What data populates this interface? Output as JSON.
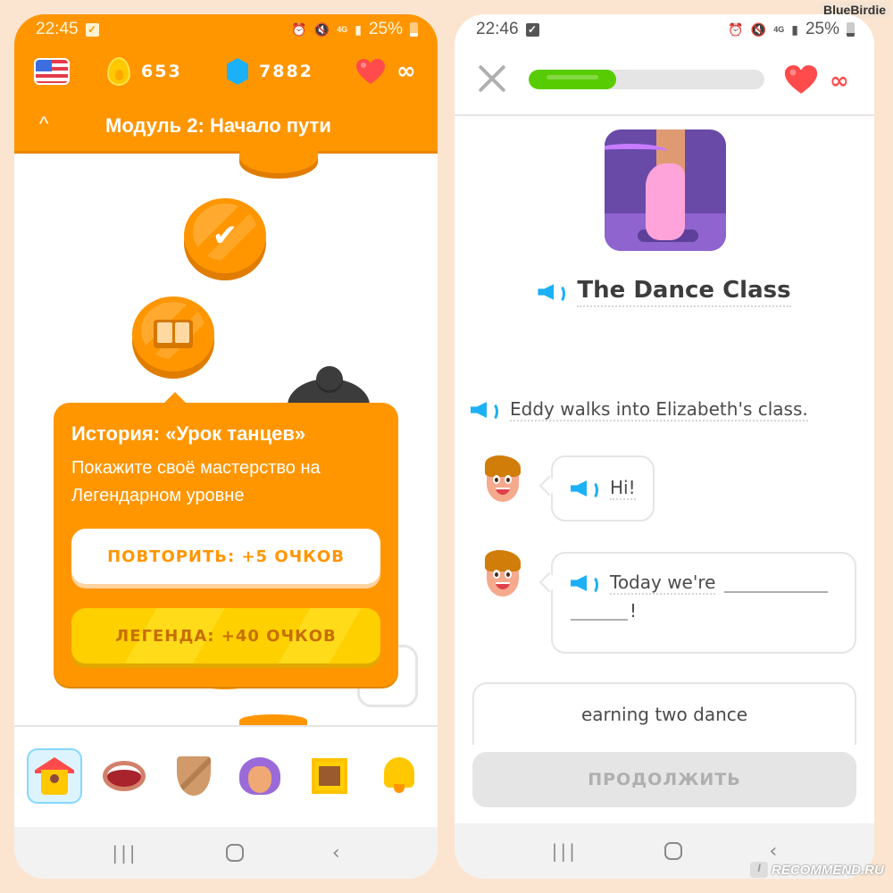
{
  "watermark": "BlueBirdie",
  "footer_watermark": "RECOMMEND.RU",
  "colors": {
    "duo_orange": "#ff9600",
    "duo_green": "#58cc02",
    "duo_blue": "#1cb0f6",
    "duo_red": "#ff4b4b",
    "legend_gold": "#ffd000",
    "page_background": "#fbe5d0"
  },
  "left_screen": {
    "status_bar": {
      "time": "22:45",
      "battery": "25%",
      "network": "4G",
      "icons": [
        "notification-check-icon",
        "alarm-icon",
        "mute-icon",
        "4g-icon",
        "signal-icon",
        "battery-icon"
      ]
    },
    "stats": {
      "course_flag": "flag-us-icon",
      "streak": "653",
      "gems": "7882",
      "hearts": "∞"
    },
    "module": {
      "collapse_icon": "^",
      "title": "Модуль 2: Начало пути"
    },
    "path_nodes": [
      {
        "type": "partial",
        "icon": "none",
        "state": "completed"
      },
      {
        "type": "lesson",
        "icon": "check-icon",
        "glyph": "✔",
        "state": "completed"
      },
      {
        "type": "story",
        "icon": "book-icon",
        "state": "active"
      },
      {
        "type": "chest",
        "icon": "chest-icon",
        "state": "locked"
      }
    ],
    "popup": {
      "title": "История: «Урок танцев»",
      "description": "Покажите своё мастерство на Легендарном уровне",
      "repeat_button": "ПОВТОРИТЬ: +5 ОЧКОВ",
      "legend_button": "ЛЕГЕНДА: +40 ОЧКОВ"
    },
    "bottom_nav": [
      {
        "name": "home",
        "icon": "house-icon",
        "active": true
      },
      {
        "name": "speaking",
        "icon": "mouth-icon",
        "active": false
      },
      {
        "name": "leagues",
        "icon": "shield-icon",
        "active": false
      },
      {
        "name": "profile",
        "icon": "avatar-icon",
        "active": false
      },
      {
        "name": "shop",
        "icon": "chest-icon",
        "active": false
      },
      {
        "name": "notifications",
        "icon": "bell-icon",
        "active": false
      }
    ],
    "system_nav": {
      "recent": "|||",
      "home": "○",
      "back": "‹"
    }
  },
  "right_screen": {
    "status_bar": {
      "time": "22:46",
      "battery": "25%",
      "network": "4G"
    },
    "lesson_header": {
      "close_icon": "close-icon",
      "progress": 0.37,
      "hearts": "∞"
    },
    "story": {
      "title": "The Dance Class",
      "illustration": "ballet-shoe-icon",
      "narration": "Eddy walks into Elizabeth's class.",
      "dialog": [
        {
          "speaker": "Eddy",
          "text": "Hi!"
        },
        {
          "speaker": "Eddy",
          "text_prefix": "Today we're",
          "text_suffix": "!"
        }
      ],
      "answer_option": "earning two dance"
    },
    "continue_button": "ПРОДОЛЖИТЬ",
    "system_nav": {
      "recent": "|||",
      "home": "○",
      "back": "‹"
    }
  }
}
